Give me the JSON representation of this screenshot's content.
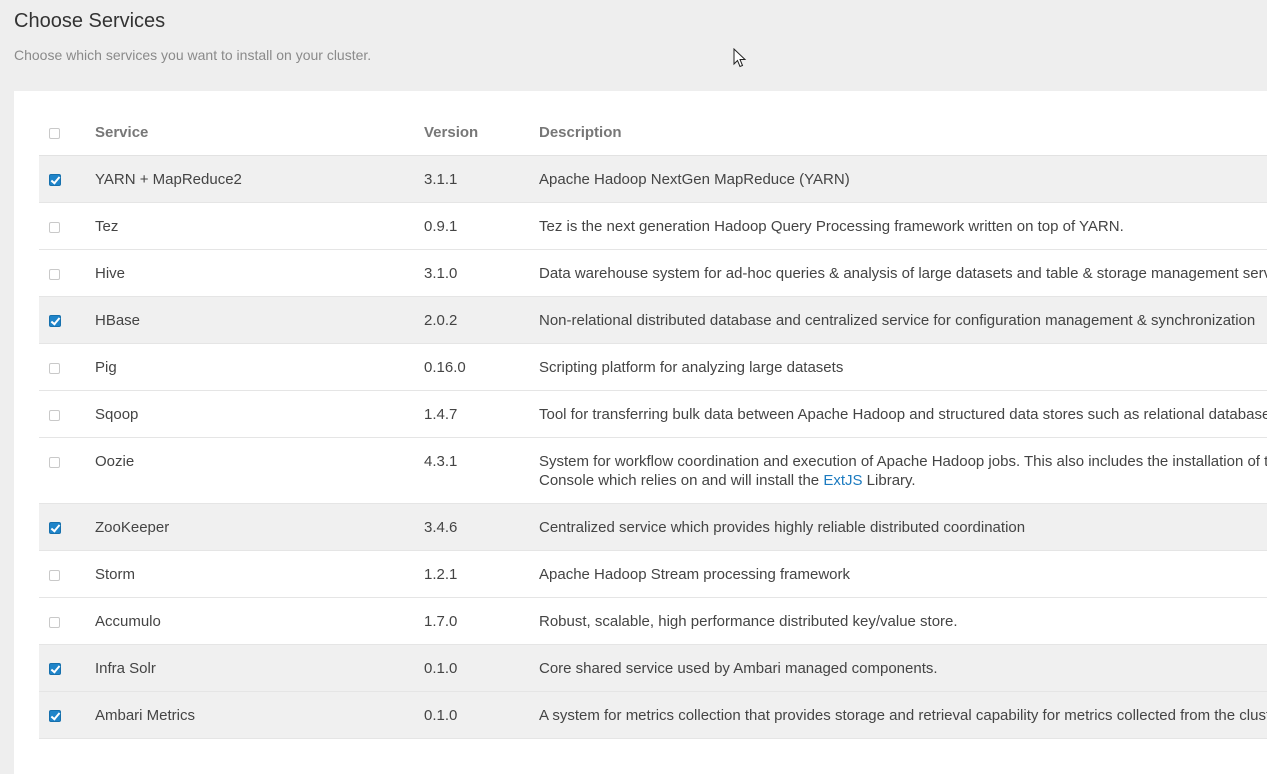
{
  "header": {
    "title": "Choose Services",
    "subtitle": "Choose which services you want to install on your cluster."
  },
  "table": {
    "columns": {
      "service": "Service",
      "version": "Version",
      "description": "Description"
    },
    "select_all_checked": false,
    "rows": [
      {
        "service": "YARN + MapReduce2",
        "version": "3.1.1",
        "checked": true,
        "description": "Apache Hadoop NextGen MapReduce (YARN)"
      },
      {
        "service": "Tez",
        "version": "0.9.1",
        "checked": false,
        "description": "Tez is the next generation Hadoop Query Processing framework written on top of YARN."
      },
      {
        "service": "Hive",
        "version": "3.1.0",
        "checked": false,
        "description": "Data warehouse system for ad-hoc queries & analysis of large datasets and table & storage management service"
      },
      {
        "service": "HBase",
        "version": "2.0.2",
        "checked": true,
        "description": "Non-relational distributed database and centralized service for configuration management & synchronization"
      },
      {
        "service": "Pig",
        "version": "0.16.0",
        "checked": false,
        "description": "Scripting platform for analyzing large datasets"
      },
      {
        "service": "Sqoop",
        "version": "1.4.7",
        "checked": false,
        "description": "Tool for transferring bulk data between Apache Hadoop and structured data stores such as relational databases"
      },
      {
        "service": "Oozie",
        "version": "4.3.1",
        "checked": false,
        "description": "System for workflow coordination and execution of Apache Hadoop jobs. This also includes the installation of the optional Oozie Web Console which relies on and will install the",
        "link": "ExtJS",
        "description_suffix": " Library."
      },
      {
        "service": "ZooKeeper",
        "version": "3.4.6",
        "checked": true,
        "description": "Centralized service which provides highly reliable distributed coordination"
      },
      {
        "service": "Storm",
        "version": "1.2.1",
        "checked": false,
        "description": "Apache Hadoop Stream processing framework"
      },
      {
        "service": "Accumulo",
        "version": "1.7.0",
        "checked": false,
        "description": "Robust, scalable, high performance distributed key/value store."
      },
      {
        "service": "Infra Solr",
        "version": "0.1.0",
        "checked": true,
        "description": "Core shared service used by Ambari managed components."
      },
      {
        "service": "Ambari Metrics",
        "version": "0.1.0",
        "checked": true,
        "description": "A system for metrics collection that provides storage and retrieval capability for metrics collected from the cluster"
      }
    ]
  }
}
